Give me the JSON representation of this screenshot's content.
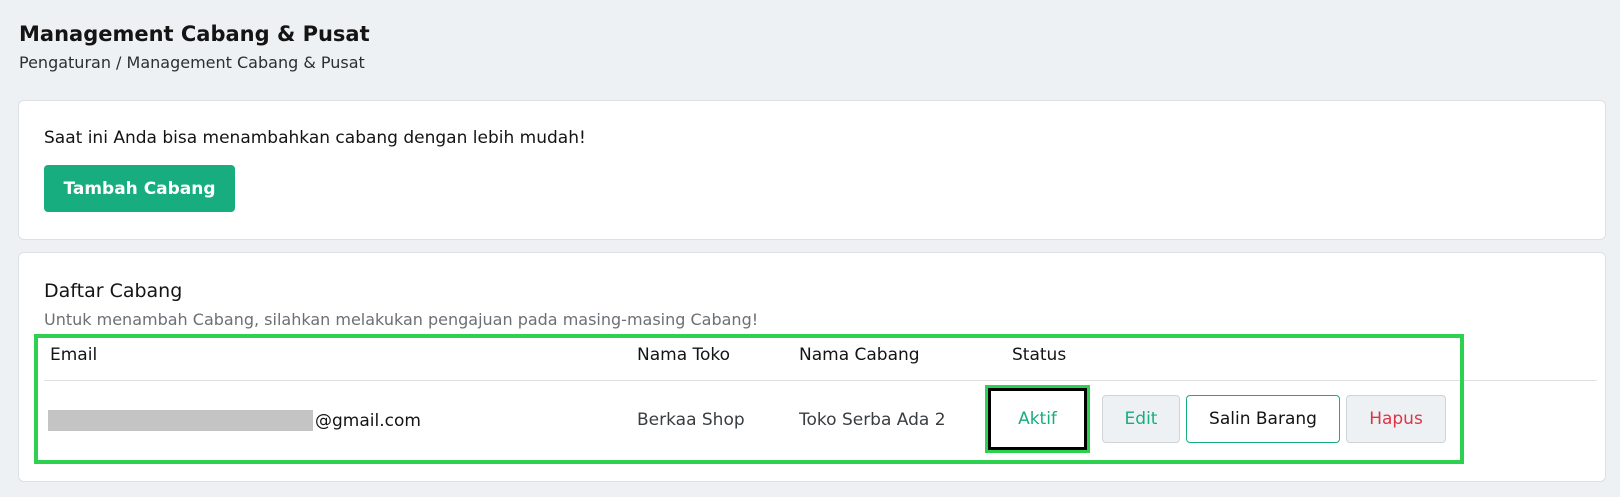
{
  "page": {
    "title": "Management Cabang & Pusat",
    "breadcrumb": "Pengaturan / Management Cabang & Pusat"
  },
  "promo": {
    "text": "Saat ini Anda bisa menambahkan cabang dengan lebih mudah!",
    "button_label": "Tambah Cabang"
  },
  "branch_list": {
    "title": "Daftar Cabang",
    "subtitle": "Untuk menambah Cabang, silahkan melakukan pengajuan pada masing-masing Cabang!",
    "columns": {
      "email": "Email",
      "store_name": "Nama Toko",
      "branch_name": "Nama Cabang",
      "status": "Status"
    },
    "rows": [
      {
        "email_suffix": "@gmail.com",
        "store_name": "Berkaa Shop",
        "branch_name": "Toko Serba Ada 2",
        "status": "Aktif",
        "actions": {
          "edit": "Edit",
          "copy_items": "Salin Barang",
          "delete": "Hapus"
        }
      }
    ]
  },
  "colors": {
    "primary": "#17ad7e",
    "danger": "#dc3545",
    "highlight": "#2ed04f",
    "background": "#eef1f4"
  }
}
